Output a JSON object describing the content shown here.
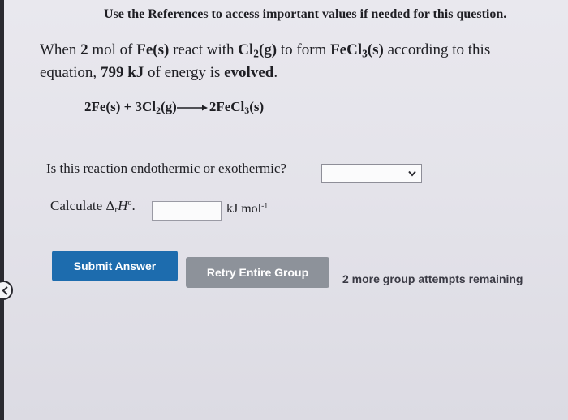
{
  "references_note": "Use the References to access important values if needed for this question.",
  "problem": {
    "text1": "When ",
    "moles": "2",
    "text2": " mol of ",
    "reactant1": "Fe(s)",
    "text3": " react with ",
    "reactant2_main": "Cl",
    "reactant2_sub": "2",
    "reactant2_state": "(g)",
    "text4": " to form ",
    "product_main": "FeCl",
    "product_sub": "3",
    "product_state": "(s)",
    "text5": " according to this equation, ",
    "energy": "799 kJ",
    "text6": " of energy is ",
    "verb": "evolved",
    "text7": "."
  },
  "equation": {
    "left1": "2Fe(s) + 3Cl",
    "left1_sub": "2",
    "left1_state": "(g)",
    "right": "2FeCl",
    "right_sub": "3",
    "right_state": "(s)"
  },
  "question1": {
    "label": "Is this reaction endothermic or exothermic?",
    "selected_value": ""
  },
  "question2": {
    "prefix": "Calculate ",
    "delta": "Δ",
    "delta_sub": "r",
    "h": "H",
    "h_sup": "o",
    "suffix": ".",
    "input_value": "",
    "unit": "kJ mol",
    "unit_sup": "-1"
  },
  "buttons": {
    "submit": "Submit Answer",
    "retry": "Retry Entire Group"
  },
  "attempts_text": "2 more group attempts remaining",
  "colors": {
    "submit_bg": "#1d6cae",
    "retry_bg": "#8d929a"
  }
}
